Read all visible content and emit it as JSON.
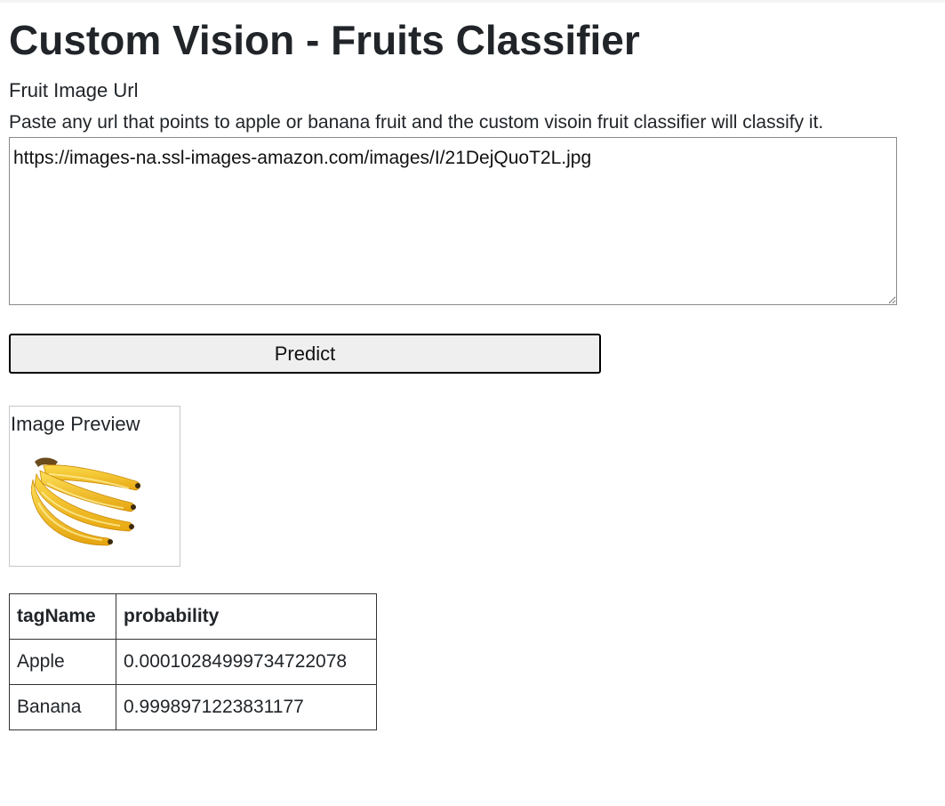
{
  "page": {
    "title": "Custom Vision - Fruits Classifier"
  },
  "form": {
    "label": "Fruit Image Url",
    "help_text": "Paste any url that points to apple or banana fruit and the custom visoin fruit classifier will classify it.",
    "url_value": "https://images-na.ssl-images-amazon.com/images/I/21DejQuoT2L.jpg",
    "predict_label": "Predict"
  },
  "preview": {
    "title": "Image Preview",
    "image": "banana-bunch-image"
  },
  "results": {
    "headers": [
      "tagName",
      "probability"
    ],
    "rows": [
      {
        "tagName": "Apple",
        "probability": "0.00010284999734722078"
      },
      {
        "tagName": "Banana",
        "probability": "0.9998971223831177"
      }
    ]
  },
  "colors": {
    "text": "#212529",
    "button_bg": "#efefef",
    "banana_yellow": "#f5c518"
  }
}
